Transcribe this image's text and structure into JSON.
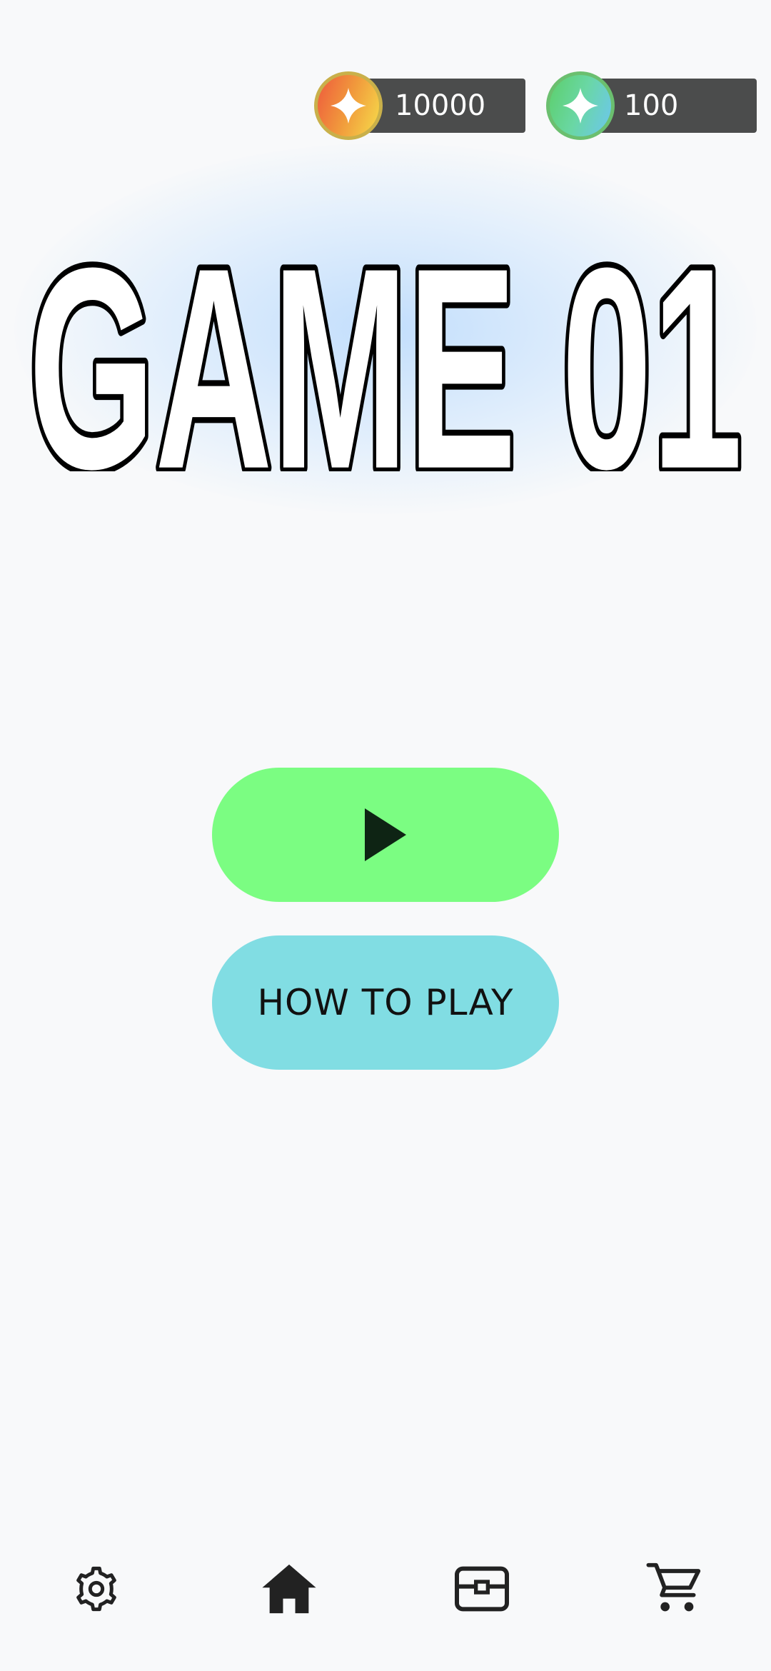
{
  "currencies": {
    "coins": {
      "value": "10000",
      "icon": "coin-star-icon",
      "colors": [
        "#ee5a3c",
        "#f6dc4a"
      ]
    },
    "gems": {
      "value": "100",
      "icon": "gem-star-icon",
      "colors": [
        "#5ccf6a",
        "#6cc6f0"
      ]
    }
  },
  "title": {
    "text": "GAME 01",
    "fill_color": "#ffffff",
    "outline_color": "#000000",
    "glow_color": "#9ccaff"
  },
  "buttons": {
    "play": {
      "icon": "play-icon",
      "color": "#7bfd82"
    },
    "how_to_play": {
      "label": "HOW TO PLAY",
      "color": "#81dde3"
    }
  },
  "nav": {
    "items": [
      {
        "icon": "gear-icon"
      },
      {
        "icon": "home-icon"
      },
      {
        "icon": "chest-icon"
      },
      {
        "icon": "cart-icon"
      }
    ]
  }
}
